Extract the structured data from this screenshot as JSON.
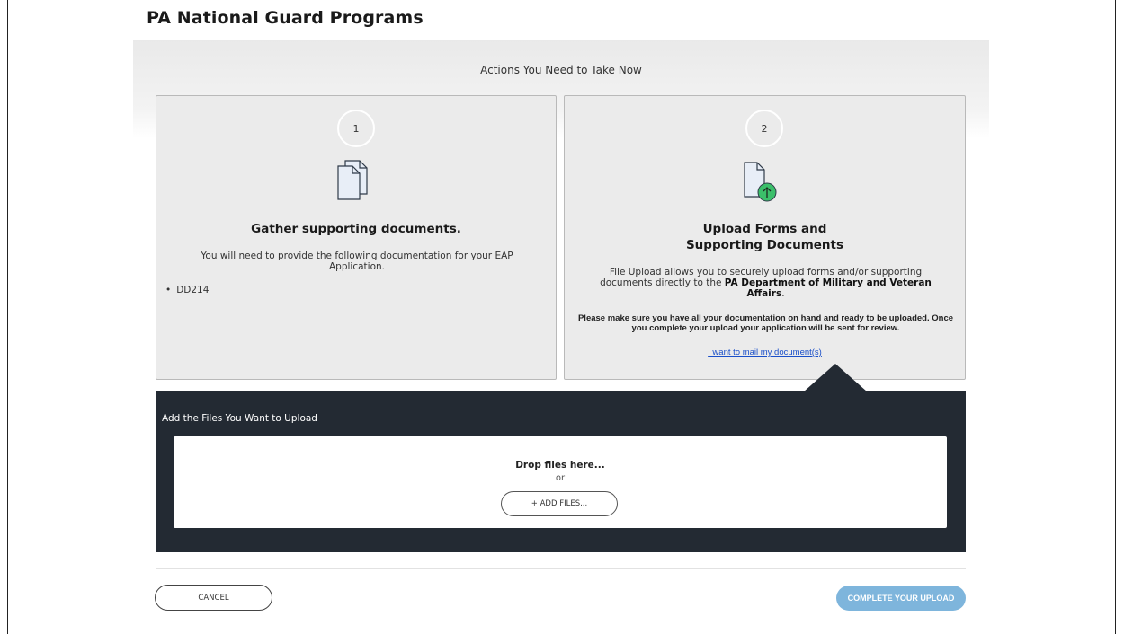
{
  "page": {
    "title": "PA National Guard Programs"
  },
  "section": {
    "heading": "Actions You Need to Take Now"
  },
  "steps": [
    {
      "number": "1",
      "icon": "documents-icon",
      "title": "Gather supporting documents.",
      "text": "You will need to provide the following documentation for your EAP Application.",
      "items": [
        "DD214"
      ]
    },
    {
      "number": "2",
      "icon": "upload-document-icon",
      "title_line1": "Upload Forms and",
      "title_line2": "Supporting Documents",
      "text_before": "File Upload allows you to securely upload forms and/or supporting documents directly to the ",
      "text_bold": "PA Department of Military and Veteran Affairs",
      "text_after": ".",
      "note": "Please make sure you have all your documentation on hand and ready to be uploaded. Once you complete your upload your application will be sent for review.",
      "link": "I want to mail my document(s)"
    }
  ],
  "upload": {
    "label": "Add the Files You Want to Upload",
    "drop_text": "Drop files here...",
    "or_text": "or",
    "add_button": "+ ADD FILES..."
  },
  "footer": {
    "cancel": "CANCEL",
    "complete": "COMPLETE YOUR UPLOAD"
  },
  "colors": {
    "panel_dark": "#232a33",
    "accent_button": "#7eb5dc",
    "upload_icon_green": "#3bbf6a",
    "link": "#1a4fc9"
  }
}
